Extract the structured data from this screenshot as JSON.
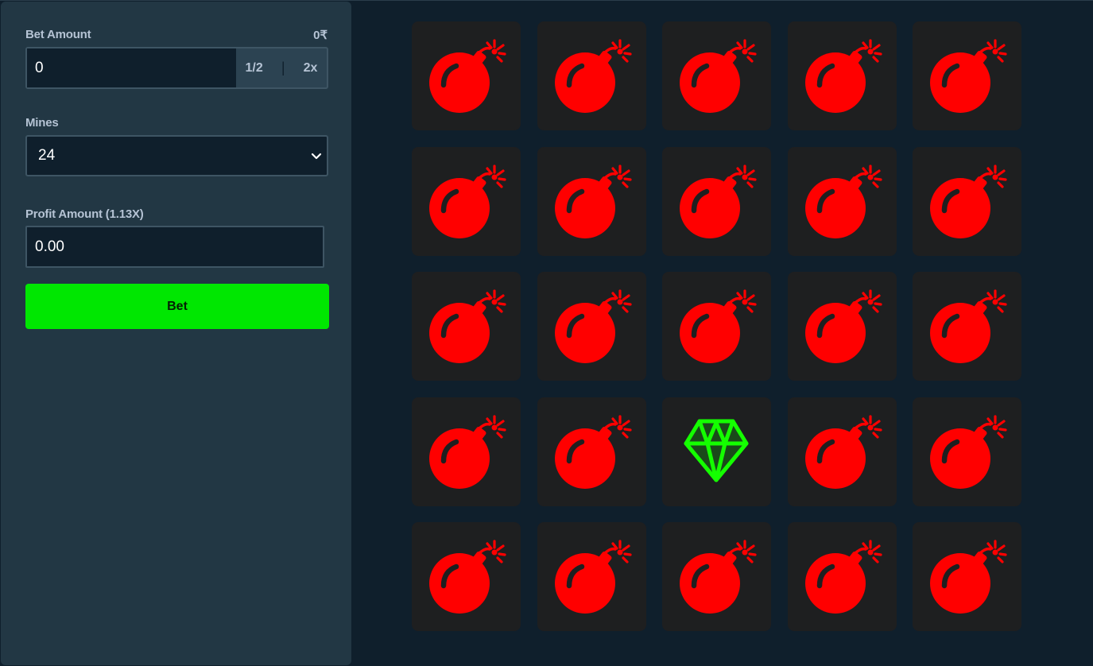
{
  "bet_amount": {
    "label": "Bet Amount",
    "balance": "0₹",
    "value": "0",
    "half_label": "1/2",
    "separator": "|",
    "double_label": "2x"
  },
  "mines": {
    "label": "Mines",
    "selected": "24"
  },
  "profit": {
    "label": "Profit Amount (1.13X)",
    "value": "0.00"
  },
  "bet_button": {
    "label": "Bet"
  },
  "colors": {
    "panel": "#223744",
    "background": "#0f1f2c",
    "bet_button": "#00e701",
    "mine": "#ff0000",
    "gem": "#14ff00",
    "tile": "#1e1f20"
  },
  "board": {
    "rows": 5,
    "cols": 5,
    "tiles": [
      "mine",
      "mine",
      "mine",
      "mine",
      "mine",
      "mine",
      "mine",
      "mine",
      "mine",
      "mine",
      "mine",
      "mine",
      "mine",
      "mine",
      "mine",
      "mine",
      "mine",
      "gem",
      "mine",
      "mine",
      "mine",
      "mine",
      "mine",
      "mine",
      "mine"
    ]
  }
}
